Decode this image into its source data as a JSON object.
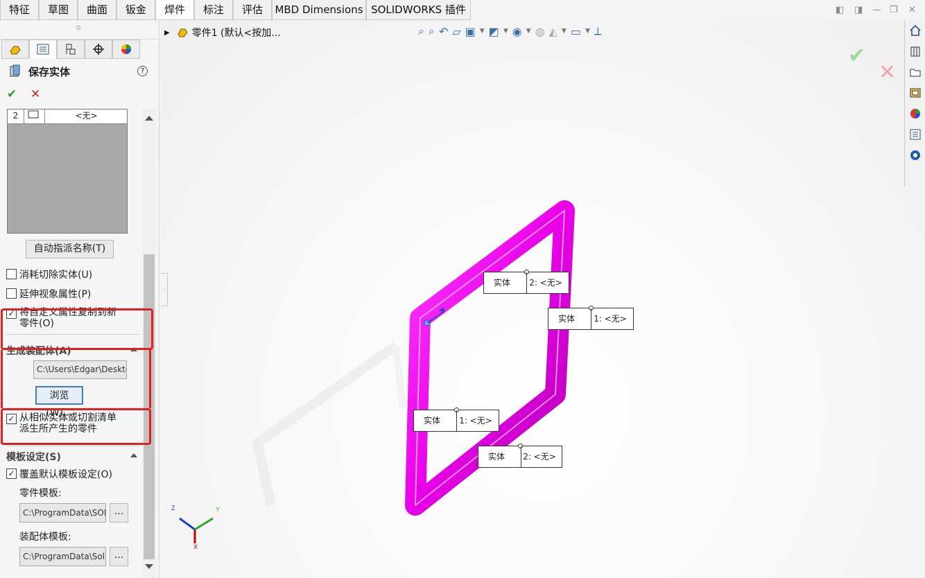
{
  "tabs": [
    "特征",
    "草图",
    "曲面",
    "钣金",
    "焊件",
    "标注",
    "评估",
    "MBD Dimensions",
    "SOLIDWORKS 插件"
  ],
  "active_tab": "焊件",
  "panel": {
    "title": "保存实体",
    "help": "?",
    "ok": "✔",
    "cancel": "✕",
    "list_row": {
      "num": "2",
      "value": "<无>"
    },
    "auto_assign": "自动指派名称(T)",
    "consume_cut": "消耗切除实体(U)",
    "propagate_visual": "延伸视象属性(P)",
    "copy_custom_props": "将自定义属性复制到新零件(O)",
    "assembly_section": "生成装配体(A)",
    "assembly_path": "C:\\Users\\Edgar\\Desktop",
    "browse": "浏览(W)...",
    "derive_parts": "从相似实体或切割清单派生所产生的零件",
    "template_section": "模板设定(S)",
    "override_template": "覆盖默认模板设定(O)",
    "part_template_label": "零件模板:",
    "part_template_path": "C:\\ProgramData\\SOLIDWORKS",
    "assembly_template_label": "装配体模板:",
    "assembly_template_path": "C:\\ProgramData\\SolidWorks",
    "ellipsis": "..."
  },
  "checkboxes": {
    "consume_cut": false,
    "propagate_visual": false,
    "copy_custom_props": true,
    "derive_parts": true,
    "override_template": true
  },
  "viewport": {
    "feature_path": "零件1 (默认<按加...",
    "callouts": [
      {
        "label": "实体",
        "value": "2: <无>"
      },
      {
        "label": "实体",
        "value": "1: <无>"
      },
      {
        "label": "实体",
        "value": "1: <无>"
      },
      {
        "label": "实体",
        "value": "2: <无>"
      }
    ],
    "triad": {
      "x": "X",
      "y": "Y",
      "z": "Z"
    }
  },
  "colors": {
    "body": "#e800e8",
    "highlight": "#e02020",
    "ok": "#2b9a2b"
  }
}
